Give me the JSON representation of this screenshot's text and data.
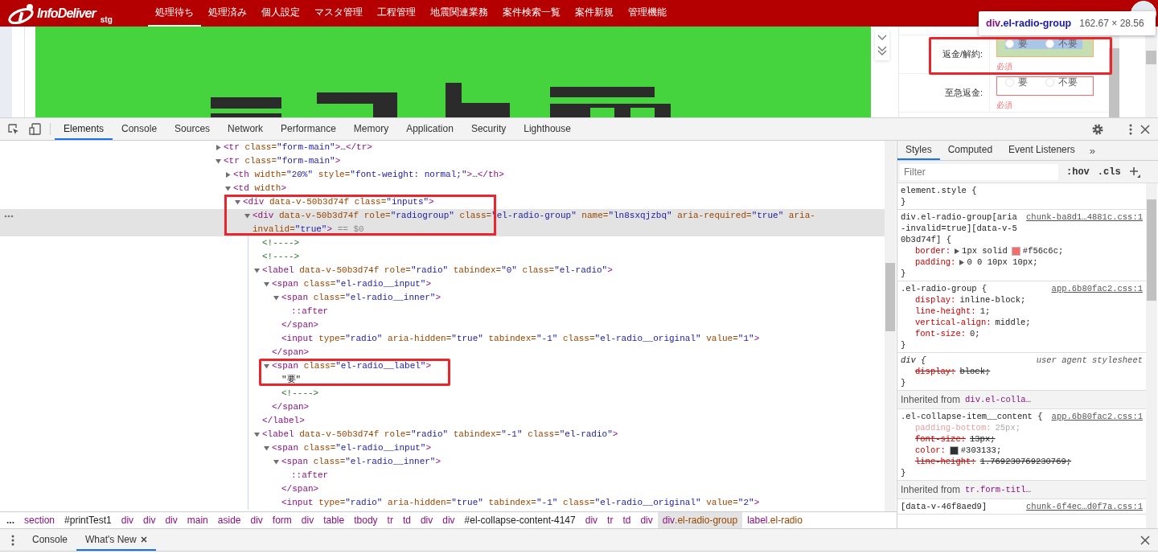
{
  "site": {
    "logo": "InfoDeliver",
    "env": "stg",
    "nav": [
      {
        "label": "処理待ち",
        "selected": true
      },
      {
        "label": "処理済み",
        "selected": false
      },
      {
        "label": "個人設定",
        "selected": false
      },
      {
        "label": "マスタ管理",
        "selected": false
      },
      {
        "label": "工程管理",
        "selected": false
      },
      {
        "label": "地震関連業務",
        "selected": false
      },
      {
        "label": "案件検索一覧",
        "selected": false
      },
      {
        "label": "案件新規",
        "selected": false
      },
      {
        "label": "管理機能",
        "selected": false
      }
    ],
    "form": {
      "rows": [
        {
          "label": "返金/解約:",
          "inspected": true,
          "error": "必須",
          "options": [
            {
              "label": "要",
              "selected": false
            },
            {
              "label": "不要",
              "selected": false
            }
          ]
        },
        {
          "label": "至急返金:",
          "inspected": false,
          "error": "必須",
          "options": [
            {
              "label": "要",
              "selected": false
            },
            {
              "label": "不要",
              "selected": false
            }
          ]
        }
      ]
    },
    "tooltip": {
      "selector": "div.el-radio-group",
      "size": "162.67 × 28.56"
    }
  },
  "devtools": {
    "tabs": [
      {
        "label": "Elements",
        "selected": true
      },
      {
        "label": "Console",
        "selected": false
      },
      {
        "label": "Sources",
        "selected": false
      },
      {
        "label": "Network",
        "selected": false
      },
      {
        "label": "Performance",
        "selected": false
      },
      {
        "label": "Memory",
        "selected": false
      },
      {
        "label": "Application",
        "selected": false
      },
      {
        "label": "Security",
        "selected": false
      },
      {
        "label": "Lighthouse",
        "selected": false
      }
    ],
    "tree": [
      {
        "html": "<tr class=\"form-main\">…</tr>",
        "expanded": false,
        "selected": false
      },
      {
        "html": "<tr class=\"form-main\">",
        "expanded": true,
        "selected": false,
        "children": [
          {
            "html": "<th width=\"20%\" style=\"font-weight: normal;\">…</th>",
            "expanded": false,
            "selected": false
          },
          {
            "html": "<td width>",
            "expanded": true,
            "selected": false,
            "children": [
              {
                "html": "<div data-v-50b3d74f class=\"inputs\">",
                "expanded": true,
                "selected": false,
                "children": [
                  {
                    "html": "<div data-v-50b3d74f role=\"radiogroup\" class=\"el-radio-group\" name=\"ln8sxqjzbq\" aria-required=\"true\" aria-invalid=\"true\">",
                    "suffix": "== $0",
                    "expanded": true,
                    "selected": true,
                    "children": [
                      {
                        "html": "<!---->",
                        "selected": false
                      },
                      {
                        "html": "<!---->",
                        "selected": false
                      },
                      {
                        "html": "<label data-v-50b3d74f role=\"radio\" tabindex=\"0\" class=\"el-radio\">",
                        "expanded": true,
                        "selected": false,
                        "children": [
                          {
                            "html": "<span class=\"el-radio__input\">",
                            "expanded": true,
                            "selected": false,
                            "children": [
                              {
                                "html": "<span class=\"el-radio__inner\">",
                                "expanded": true,
                                "selected": false,
                                "children": [
                                  {
                                    "html": "::after",
                                    "selected": false
                                  }
                                ]
                              },
                              {
                                "html": "</span>",
                                "selected": false
                              },
                              {
                                "html": "<input type=\"radio\" aria-hidden=\"true\" tabindex=\"-1\" class=\"el-radio__original\" value=\"1\">",
                                "selected": false
                              }
                            ]
                          },
                          {
                            "html": "</span>",
                            "selected": false
                          },
                          {
                            "html": "<span class=\"el-radio__label\">",
                            "expanded": true,
                            "selected": false,
                            "children": [
                              {
                                "html": "\"要\"",
                                "selected": false
                              },
                              {
                                "html": "<!---->",
                                "selected": false
                              }
                            ]
                          },
                          {
                            "html": "</span>",
                            "selected": false
                          }
                        ]
                      },
                      {
                        "html": "</label>",
                        "selected": false
                      },
                      {
                        "html": "<label data-v-50b3d74f role=\"radio\" tabindex=\"-1\" class=\"el-radio\">",
                        "expanded": true,
                        "selected": false,
                        "children": [
                          {
                            "html": "<span class=\"el-radio__input\">",
                            "expanded": true,
                            "selected": false,
                            "children": [
                              {
                                "html": "<span class=\"el-radio__inner\">",
                                "expanded": true,
                                "selected": false,
                                "children": [
                                  {
                                    "html": "::after",
                                    "selected": false
                                  }
                                ]
                              },
                              {
                                "html": "</span>",
                                "selected": false
                              },
                              {
                                "html": "<input type=\"radio\" aria-hidden=\"true\" tabindex=\"-1\" class=\"el-radio__original\" value=\"2\">",
                                "selected": false
                              }
                            ]
                          }
                        ]
                      }
                    ]
                  }
                ]
              }
            ]
          }
        ]
      }
    ],
    "breadcrumbs": {
      "overflow": "...",
      "items": [
        {
          "label": "section",
          "selected": false
        },
        {
          "label": "#printTest1",
          "selected": false
        },
        {
          "label": "div",
          "selected": false
        },
        {
          "label": "div",
          "selected": false
        },
        {
          "label": "div",
          "selected": false
        },
        {
          "label": "main",
          "selected": false
        },
        {
          "label": "aside",
          "selected": false
        },
        {
          "label": "div",
          "selected": false
        },
        {
          "label": "form",
          "selected": false
        },
        {
          "label": "div",
          "selected": false
        },
        {
          "label": "table",
          "selected": false
        },
        {
          "label": "tbody",
          "selected": false
        },
        {
          "label": "tr",
          "selected": false
        },
        {
          "label": "td",
          "selected": false
        },
        {
          "label": "div",
          "selected": false
        },
        {
          "label": "div",
          "selected": false
        },
        {
          "label": "#el-collapse-content-4147",
          "selected": false
        },
        {
          "label": "div",
          "selected": false
        },
        {
          "label": "tr",
          "selected": false
        },
        {
          "label": "td",
          "selected": false
        },
        {
          "label": "div",
          "selected": false
        },
        {
          "label": "div.el-radio-group",
          "selected": true
        },
        {
          "label": "label.el-radio",
          "selected": false
        }
      ]
    },
    "styles": {
      "tabs": [
        {
          "label": "Styles",
          "selected": true
        },
        {
          "label": "Computed",
          "selected": false
        },
        {
          "label": "Event Listeners",
          "selected": false
        }
      ],
      "more": "»",
      "filter": {
        "placeholder": "Filter"
      },
      "hov": ":hov",
      "cls": ".cls",
      "sections": [
        {
          "kind": "rule",
          "selector": "element.style {",
          "close": "}"
        },
        {
          "kind": "rule",
          "selector": "div.el-radio-group[aria-invalid=true][data-v-50b3d74f] {",
          "source": "chunk-ba8d1…4881c.css:1",
          "close": "}",
          "declarations": [
            {
              "name": "border:",
              "value": "1px solid #f56c6c;",
              "swatch": true,
              "expanded": false,
              "overridden": false,
              "inactive": false
            },
            {
              "name": "padding:",
              "value": "0 0 10px 10px;",
              "expanded": false,
              "overridden": false,
              "inactive": false
            }
          ]
        },
        {
          "kind": "rule",
          "selector": ".el-radio-group {",
          "source": "app.6b80fac2.css:1",
          "close": "}",
          "declarations": [
            {
              "name": "display:",
              "value": "inline-block;",
              "overridden": false,
              "inactive": false
            },
            {
              "name": "line-height:",
              "value": "1;",
              "overridden": false,
              "inactive": false
            },
            {
              "name": "vertical-align:",
              "value": "middle;",
              "overridden": false,
              "inactive": false
            },
            {
              "name": "font-size:",
              "value": "0;",
              "overridden": false,
              "inactive": false
            }
          ]
        },
        {
          "kind": "user_agent",
          "selector": "div {",
          "source": "user agent stylesheet",
          "close": "}",
          "declarations": [
            {
              "name": "display:",
              "value": "block;",
              "overridden": true,
              "inactive": false
            }
          ]
        },
        {
          "kind": "inherited",
          "label": "Inherited from",
          "from": "div.el-colla…"
        },
        {
          "kind": "rule",
          "selector": ".el-collapse-item__content {",
          "source": "app.6b80fac2.css:1",
          "close": "}",
          "declarations": [
            {
              "name": "padding-bottom:",
              "value": "25px;",
              "overridden": false,
              "inactive": true
            },
            {
              "name": "font-size:",
              "value": "13px;",
              "overridden": true,
              "inactive": false
            },
            {
              "name": "color:",
              "value": "#303133;",
              "swatch": true,
              "overridden": false,
              "inactive": false
            },
            {
              "name": "line-height:",
              "value": "1.769230769230769;",
              "overridden": true,
              "inactive": false
            }
          ]
        },
        {
          "kind": "inherited",
          "label": "Inherited from",
          "from": "tr.form-titl…"
        },
        {
          "kind": "rule",
          "selector": "[data-v-46f8aed9]",
          "source": "chunk-6f4ec…d0f7a.css:1"
        }
      ]
    },
    "drawer": {
      "tabs": [
        {
          "label": "Console",
          "selected": false,
          "closable": false
        },
        {
          "label": "What's New",
          "selected": true,
          "closable": true
        }
      ]
    }
  }
}
